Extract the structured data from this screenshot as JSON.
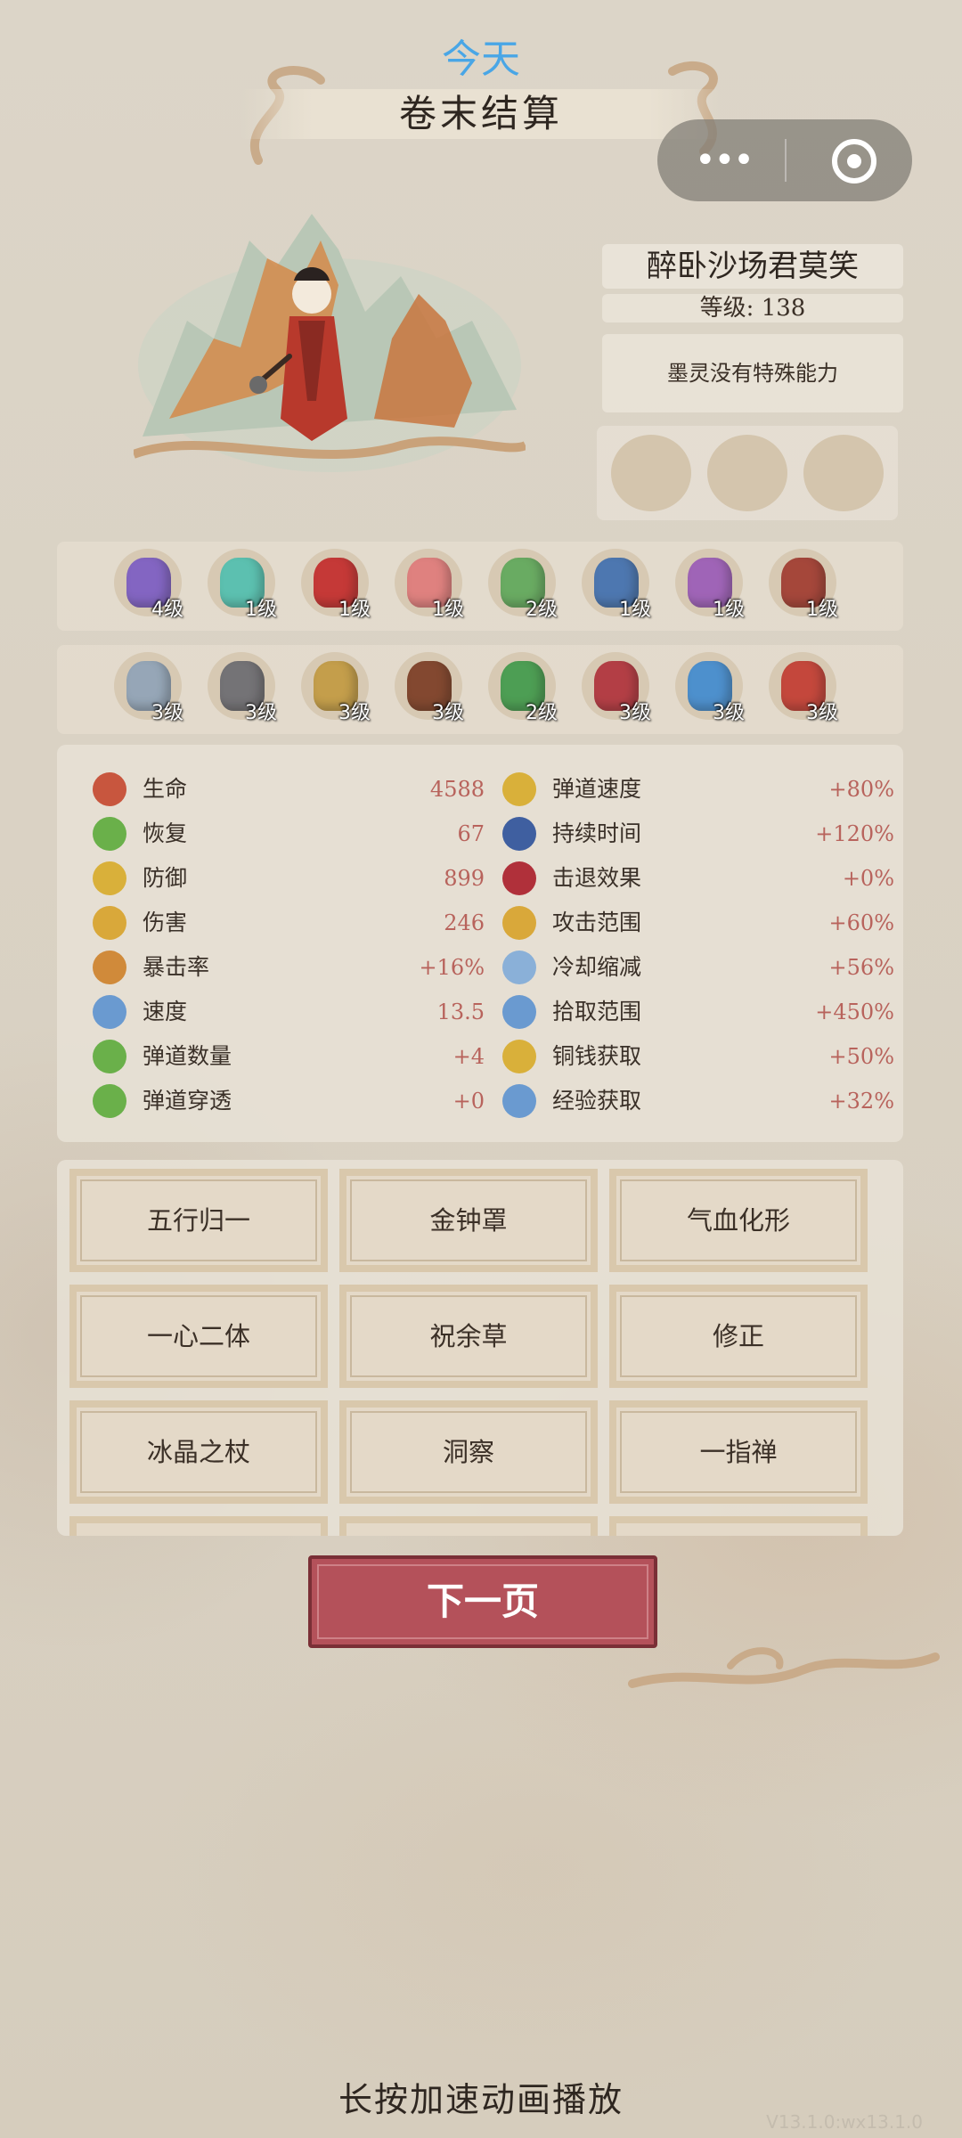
{
  "header": {
    "today": "今天",
    "title": "卷末结算"
  },
  "character": {
    "name": "醉卧沙场君莫笑",
    "level": "等级: 138",
    "ability": "墨灵没有特殊能力"
  },
  "items_row1": [
    {
      "icon": "purple-flower-icon",
      "level": "4级",
      "color": "#7a5bc4"
    },
    {
      "icon": "jade-scroll-icon",
      "level": "1级",
      "color": "#4fc0b0"
    },
    {
      "icon": "red-gem-bracelet-icon",
      "level": "1级",
      "color": "#c42a2a"
    },
    {
      "icon": "red-talisman-icon",
      "level": "1级",
      "color": "#e07a7a"
    },
    {
      "icon": "green-lotus-icon",
      "level": "2级",
      "color": "#5ea85a"
    },
    {
      "icon": "folding-fan-icon",
      "level": "1级",
      "color": "#3f6fb0"
    },
    {
      "icon": "violet-lotus-icon",
      "level": "1级",
      "color": "#9a5ab8"
    },
    {
      "icon": "bow-icon",
      "level": "1级",
      "color": "#a0392e"
    }
  ],
  "items_row2": [
    {
      "icon": "feather-fan-icon",
      "level": "3级",
      "color": "#8fa3b8"
    },
    {
      "icon": "gauntlet-icon",
      "level": "3级",
      "color": "#6a6a70"
    },
    {
      "icon": "gourd-pouch-icon",
      "level": "3级",
      "color": "#c29a40"
    },
    {
      "icon": "teapot-icon",
      "level": "3级",
      "color": "#7a3b22"
    },
    {
      "icon": "jade-ring-icon",
      "level": "2级",
      "color": "#3f9a4a"
    },
    {
      "icon": "dagger-icon",
      "level": "3级",
      "color": "#b0303a"
    },
    {
      "icon": "blue-crystal-icon",
      "level": "3级",
      "color": "#3f8ad0"
    },
    {
      "icon": "fang-necklace-icon",
      "level": "3级",
      "color": "#c23a30"
    }
  ],
  "stats_left": [
    {
      "icon": "heart-icon",
      "label": "生命",
      "value": "4588",
      "color": "#c8563e"
    },
    {
      "icon": "recover-icon",
      "label": "恢复",
      "value": "67",
      "color": "#6ab04a"
    },
    {
      "icon": "defense-icon",
      "label": "防御",
      "value": "899",
      "color": "#d9b03a"
    },
    {
      "icon": "damage-icon",
      "label": "伤害",
      "value": "246",
      "color": "#d9a83a"
    },
    {
      "icon": "crit-icon",
      "label": "暴击率",
      "value": "+16%",
      "color": "#d08a3a"
    },
    {
      "icon": "speed-icon",
      "label": "速度",
      "value": "13.5",
      "color": "#6a9ad0"
    },
    {
      "icon": "projectile-count-icon",
      "label": "弹道数量",
      "value": "+4",
      "color": "#6ab04a"
    },
    {
      "icon": "pierce-icon",
      "label": "弹道穿透",
      "value": "+0",
      "color": "#6ab04a"
    }
  ],
  "stats_right": [
    {
      "icon": "projectile-speed-icon",
      "label": "弹道速度",
      "value": "+80%",
      "color": "#d9b03a"
    },
    {
      "icon": "hourglass-icon",
      "label": "持续时间",
      "value": "+120%",
      "color": "#3f5fa0"
    },
    {
      "icon": "knockback-icon",
      "label": "击退效果",
      "value": "+0%",
      "color": "#b0303a"
    },
    {
      "icon": "range-icon",
      "label": "攻击范围",
      "value": "+60%",
      "color": "#d9a83a"
    },
    {
      "icon": "cooldown-icon",
      "label": "冷却缩减",
      "value": "+56%",
      "color": "#8ab0d8"
    },
    {
      "icon": "pickup-icon",
      "label": "拾取范围",
      "value": "+450%",
      "color": "#6a9ad0"
    },
    {
      "icon": "coin-icon",
      "label": "铜钱获取",
      "value": "+50%",
      "color": "#d9b03a"
    },
    {
      "icon": "book-icon",
      "label": "经验获取",
      "value": "+32%",
      "color": "#6a9ad0"
    }
  ],
  "skills": [
    "五行归一",
    "金钟罩",
    "气血化形",
    "一心二体",
    "祝余草",
    "修正",
    "冰晶之杖",
    "洞察",
    "一指禅"
  ],
  "buttons": {
    "next": "下一页"
  },
  "footer": {
    "hint": "长按加速动画播放",
    "version": "V13.1.0:wx13.1.0"
  }
}
